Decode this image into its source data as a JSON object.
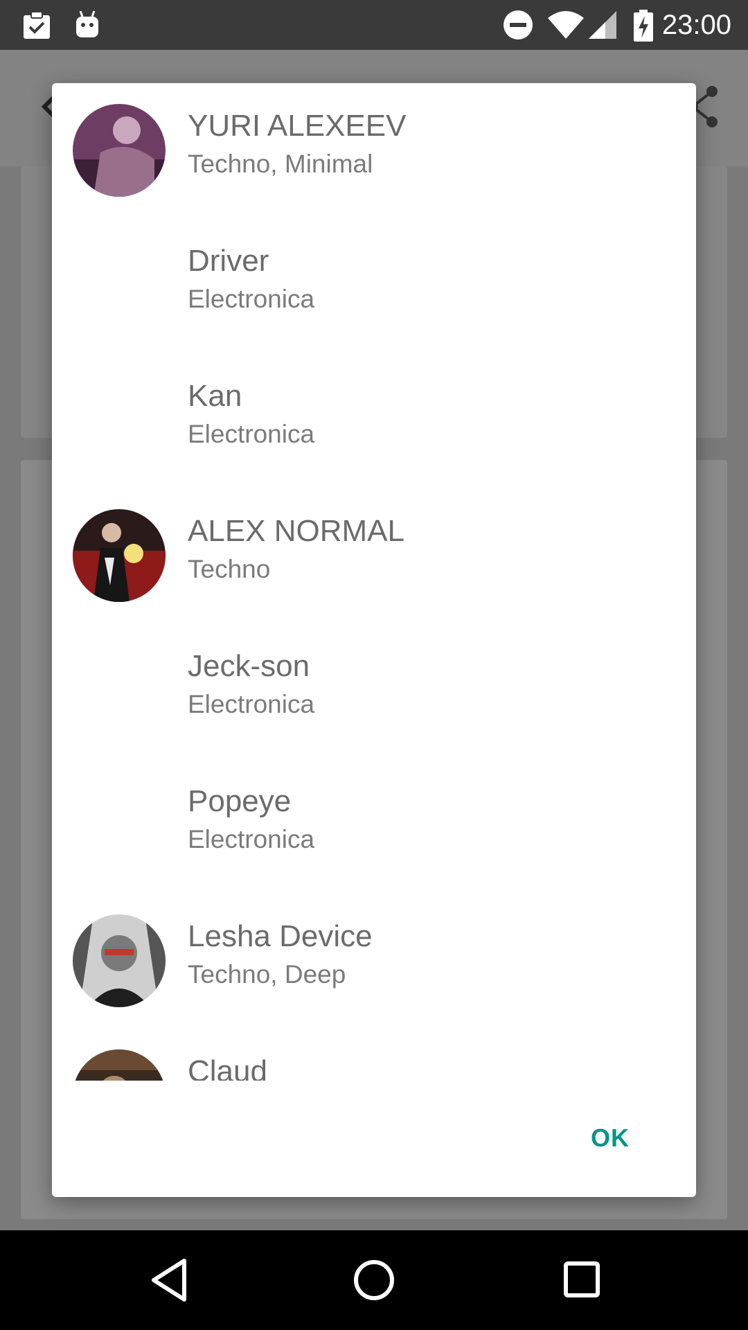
{
  "status_bar": {
    "time": "23:00",
    "icons": [
      "clipboard-check-icon",
      "android-icon",
      "do-not-disturb-icon",
      "wifi-icon",
      "signal-icon",
      "battery-charging-icon"
    ]
  },
  "dialog": {
    "items": [
      {
        "name": "YURI ALEXEEV",
        "genre": "Techno, Minimal",
        "has_avatar": true
      },
      {
        "name": "Driver",
        "genre": "Electronica",
        "has_avatar": false
      },
      {
        "name": "Kan",
        "genre": "Electronica",
        "has_avatar": false
      },
      {
        "name": "ALEX NORMAL",
        "genre": "Techno",
        "has_avatar": true
      },
      {
        "name": "Jeck-son",
        "genre": "Electronica",
        "has_avatar": false
      },
      {
        "name": "Popeye",
        "genre": "Electronica",
        "has_avatar": false
      },
      {
        "name": "Lesha Device",
        "genre": "Techno, Deep",
        "has_avatar": true
      },
      {
        "name": "Claud",
        "genre": "",
        "has_avatar": true
      }
    ],
    "ok_label": "OK",
    "accent_color": "#009688"
  },
  "nav_bar": {
    "buttons": [
      "back-icon",
      "home-icon",
      "recents-icon"
    ]
  }
}
